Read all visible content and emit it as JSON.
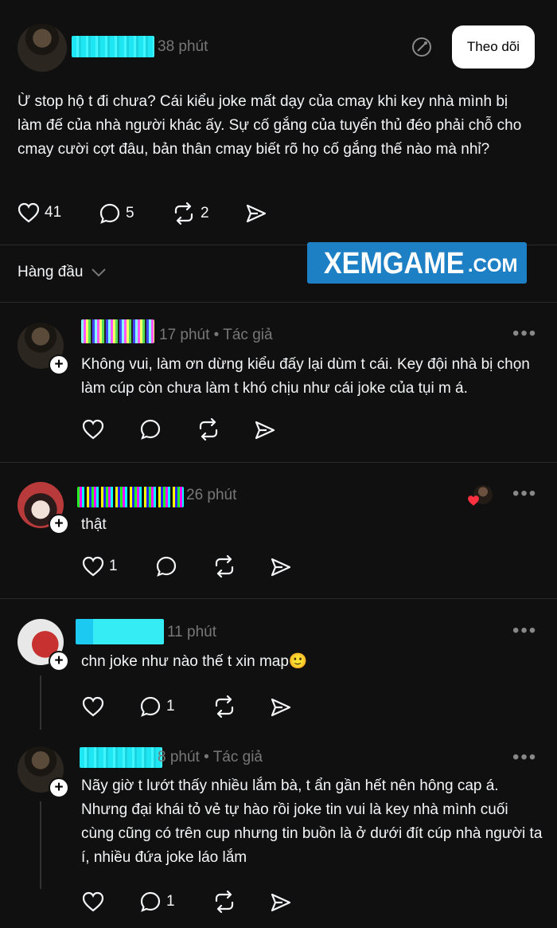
{
  "post": {
    "time": "38 phút",
    "follow_label": "Theo dõi",
    "text": "Ừ stop hộ t đi chưa? Cái kiểu joke mất dạy của cmay khi key nhà mình bị làm đế của nhà người khác ấy. Sự cố gắng của tuyển thủ đéo phải chỗ cho cmay cười cợt đâu, bản thân cmay biết rõ họ cố gắng thế nào mà nhỉ?",
    "likes": "41",
    "replies": "5",
    "reposts": "2"
  },
  "sort": {
    "label": "Hàng đầu"
  },
  "watermark": {
    "main": "XEMGAME",
    "suffix": ".COM"
  },
  "comments": [
    {
      "meta": "17 phút • Tác giả",
      "text": "Không vui, làm ơn dừng kiểu đấy lại dùm t cái. Key đội nhà bị chọn làm cúp còn chưa làm t khó chịu như cái joke của tụi m á.",
      "likes": "",
      "replies": ""
    },
    {
      "meta": "26 phút",
      "text": "thật",
      "likes": "1",
      "replies": ""
    },
    {
      "meta": "11 phút",
      "text": "chn joke như nào thế t xin map🙂",
      "likes": "",
      "replies": "1"
    },
    {
      "meta": "8 phút • Tác giả",
      "text": "Nãy giờ t lướt thấy nhiều lắm bà, t ẩn gần hết nên hông cap á. Nhưng đại khái tỏ vẻ tự hào rồi joke tin vui là key nhà mình cuối cùng cũng có trên cup nhưng tin buồn là ở dưới đít cúp nhà người ta í, nhiều đứa joke láo lắm",
      "likes": "",
      "replies": "1"
    }
  ],
  "icons": [
    "heart-icon",
    "reply-icon",
    "repost-icon",
    "share-icon",
    "ai-icon",
    "chevron-down-icon",
    "more-icon",
    "plus-icon"
  ]
}
